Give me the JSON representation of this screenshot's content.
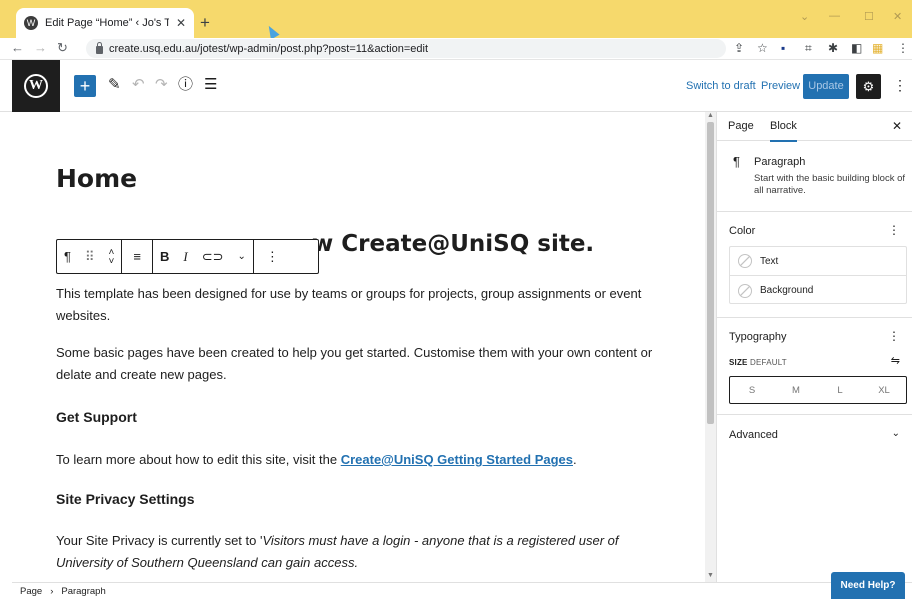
{
  "browser": {
    "tab_title": "Edit Page “Home” ‹ Jo's Test Site",
    "url": "create.usq.edu.au/jotest/wp-admin/post.php?post=11&action=edit"
  },
  "toolbar": {
    "switch_to_draft": "Switch to draft",
    "preview": "Preview",
    "update": "Update"
  },
  "content": {
    "title": "Home",
    "heading_visible": "w Create@UniSQ site.",
    "para1": "This template has been designed for use by teams or groups for projects, group assignments or event websites.",
    "para2": "Some basic pages have been created to help you get started. Customise them with your own content or delate and create new pages.",
    "subhead1": "Get Support",
    "para3_prefix": "To learn more about how to edit this site, visit the ",
    "para3_link": "Create@UniSQ Getting Started Pages",
    "para3_suffix": ".",
    "subhead2": "Site Privacy Settings",
    "para4_prefix": "Your Site Privacy is currently set to '",
    "para4_italic": "Visitors must have a login - anyone that is a registered user of University of Southern Queensland can gain access."
  },
  "sidebar": {
    "tab_page": "Page",
    "tab_block": "Block",
    "block_name": "Paragraph",
    "block_desc": "Start with the basic building block of all narrative.",
    "color_title": "Color",
    "color_text": "Text",
    "color_background": "Background",
    "typography_title": "Typography",
    "size_label": "SIZE",
    "size_value": "DEFAULT",
    "sizes": [
      "S",
      "M",
      "L",
      "XL"
    ],
    "advanced": "Advanced"
  },
  "footer": {
    "crumb_page": "Page",
    "crumb_sep": "›",
    "crumb_block": "Paragraph",
    "need_help": "Need Help?"
  },
  "icons": [
    "wordpress-logo",
    "add-block-icon",
    "tools-icon",
    "undo-icon",
    "redo-icon",
    "details-icon",
    "list-view-icon",
    "settings-gear-icon",
    "more-options-icon",
    "paragraph-icon",
    "drag-handle-icon",
    "move-up-down-icon",
    "align-icon",
    "bold-icon",
    "italic-icon",
    "link-icon",
    "more-formatting-icon"
  ]
}
